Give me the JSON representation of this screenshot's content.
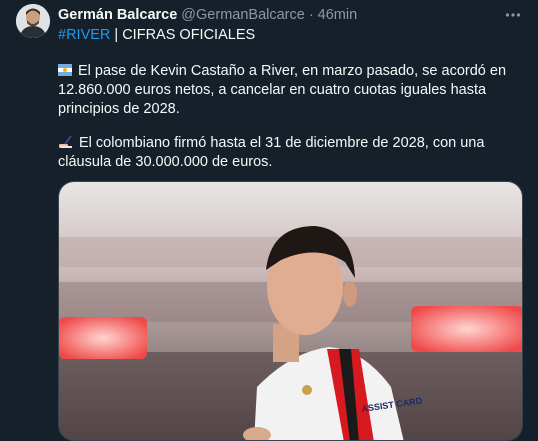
{
  "tweet": {
    "author_name": "Germán Balcarce",
    "author_handle": "@GermanBalcarce",
    "separator": "·",
    "timestamp": "46min",
    "more_icon": "more-horizontal-icon",
    "hashtag": "#RIVER",
    "headline_rest": " | CIFRAS OFICIALES",
    "paragraph1": "El pase de Kevin Castaño a River, en marzo pasado, se acordó en 12.860.000 euros netos, a cancelar en cuatro cuotas iguales hasta principios de 2028.",
    "paragraph1_icon": "argentina-flag-icon",
    "paragraph2": "El colombiano firmó hasta el 31 de diciembre de 2028, con una cláusula de 30.000.000 de euros.",
    "paragraph2_icon": "writing-hand-icon",
    "photo_jersey_text": "ASSIST CARD"
  },
  "colors": {
    "background": "#15202b",
    "link": "#1d9bf0",
    "secondary_text": "#8b98a5",
    "jersey_stripe": "#d71920"
  }
}
